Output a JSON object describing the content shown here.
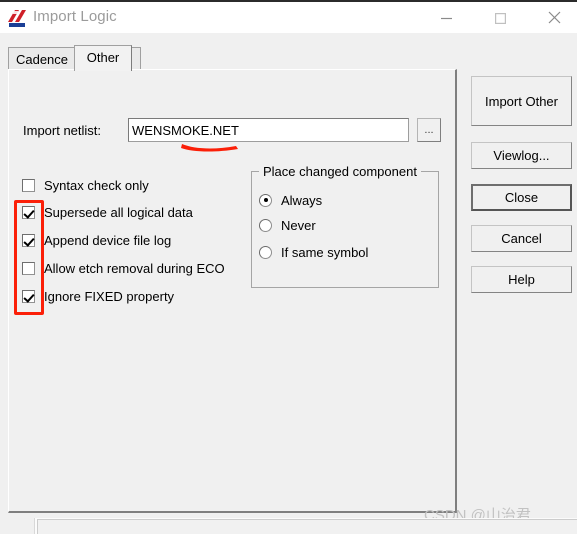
{
  "window": {
    "title": "Import Logic",
    "icon": "app-icon",
    "controls": {
      "minimize": "─",
      "maximize": "□",
      "close": "✕"
    }
  },
  "tabs": [
    {
      "label": "Cadence",
      "active": false
    },
    {
      "label": "Other",
      "active": true
    }
  ],
  "form": {
    "netlist_label": "Import netlist:",
    "netlist_value": "WENSMOKE.NET",
    "netlist_placeholder": "",
    "browse_label": "..."
  },
  "checkboxes": [
    {
      "label": "Syntax check only",
      "checked": false
    },
    {
      "label": "Supersede all logical data",
      "checked": true
    },
    {
      "label": "Append device file log",
      "checked": true
    },
    {
      "label": "Allow etch removal during ECO",
      "checked": false
    },
    {
      "label": "Ignore FIXED property",
      "checked": true
    }
  ],
  "group": {
    "title": "Place changed component",
    "options": [
      {
        "label": "Always",
        "selected": true
      },
      {
        "label": "Never",
        "selected": false
      },
      {
        "label": "If same symbol",
        "selected": false
      }
    ]
  },
  "buttons": [
    {
      "label": "Import Other",
      "default": false
    },
    {
      "label": "Viewlog...",
      "default": false
    },
    {
      "label": "Close",
      "default": true
    },
    {
      "label": "Cancel",
      "default": false
    },
    {
      "label": "Help",
      "default": false
    }
  ],
  "annotations": {
    "highlight_color": "#fb1f08",
    "checkbox_rect": "red-rectangle-around-checkboxes",
    "netlist_underline": "red-underline-under-filename"
  },
  "watermark": {
    "text": "CSDN @山治君"
  }
}
